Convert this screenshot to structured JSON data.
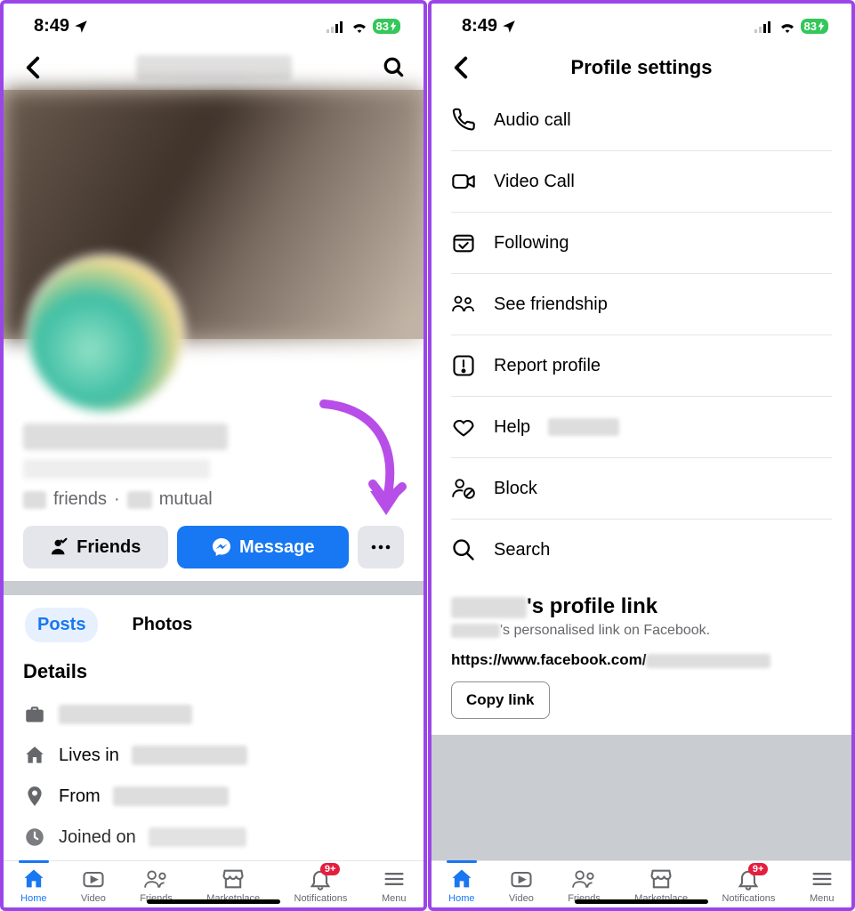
{
  "status": {
    "time": "8:49",
    "battery": "83"
  },
  "left": {
    "friends_label": "friends",
    "mutual_label": "mutual",
    "btn_friends": "Friends",
    "btn_message": "Message",
    "tabs": {
      "posts": "Posts",
      "photos": "Photos"
    },
    "details_title": "Details",
    "lives_in": "Lives in",
    "from": "From",
    "joined": "Joined on"
  },
  "right": {
    "title": "Profile settings",
    "items": {
      "audio": "Audio call",
      "video": "Video Call",
      "following": "Following",
      "friendship": "See friendship",
      "report": "Report profile",
      "help": "Help",
      "block": "Block",
      "search": "Search"
    },
    "link_title_suffix": "'s profile link",
    "link_sub_suffix": "'s personalised link on Facebook.",
    "link_url_prefix": "https://www.facebook.com/",
    "copy": "Copy link"
  },
  "tabbar": {
    "home": "Home",
    "video": "Video",
    "friends": "Friends",
    "marketplace": "Marketplace",
    "notifications": "Notifications",
    "badge": "9+",
    "menu": "Menu"
  }
}
